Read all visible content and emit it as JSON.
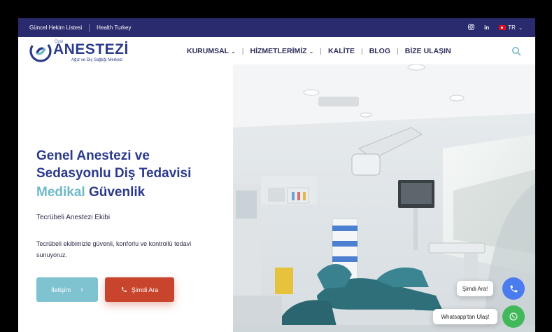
{
  "topbar": {
    "link1": "Güncel Hekim Listesi",
    "link2": "Health Turkey",
    "icons": [
      "instagram-icon",
      "linkedin-icon"
    ],
    "linkedin_text": "in",
    "lang": "TR"
  },
  "logo": {
    "ozel": "Özel",
    "name": "ANESTEZİ",
    "sub": "Ağız ve Diş Sağlığı Merkezi"
  },
  "nav": {
    "items": [
      "KURUMSAL",
      "HİZMETLERİMİZ",
      "KALİTE",
      "BLOG",
      "BİZE ULAŞIN"
    ]
  },
  "hero": {
    "title_line1": "Genel Anestezi ve",
    "title_line2": "Sedasyonlu Diş Tedavisi",
    "highlight_a": "Medikal",
    "highlight_b": "Güvenlik",
    "subtitle": "Tecrübeli Anestezi Ekibi",
    "description": "Tecrübeli ekibimizle güvenli, konforlu ve kontrollü tedavi sunuyoruz.",
    "btn_contact": "İletişim",
    "btn_call": "Şimdi Ara"
  },
  "floating": {
    "call_label": "Şimdi Ara!",
    "whatsapp_label": "Whatsapp'tan Ulaş!"
  },
  "colors": {
    "topbar": "#2a2a6e",
    "brand": "#2b3a8c",
    "accent": "#6fb9c9",
    "call_button": "#c8442c",
    "phone_fab": "#4a7cf0",
    "whatsapp_fab": "#41b85a"
  }
}
